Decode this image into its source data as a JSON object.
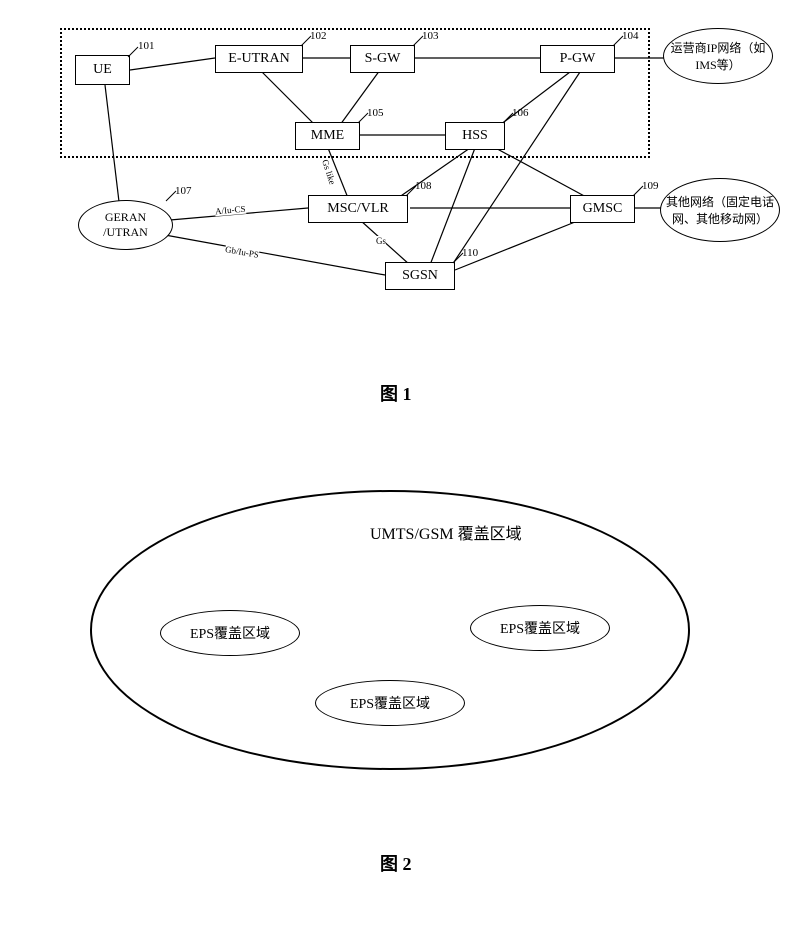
{
  "figure1": {
    "nodes": {
      "ue": {
        "label": "UE",
        "num": "101"
      },
      "eutran": {
        "label": "E-UTRAN",
        "num": "102"
      },
      "sgw": {
        "label": "S-GW",
        "num": "103"
      },
      "pgw": {
        "label": "P-GW",
        "num": "104"
      },
      "mme": {
        "label": "MME",
        "num": "105"
      },
      "hss": {
        "label": "HSS",
        "num": "106"
      },
      "geran": {
        "label": "GERAN\n/UTRAN",
        "num": "107"
      },
      "mscvlr": {
        "label": "MSC/VLR",
        "num": "108"
      },
      "gmsc": {
        "label": "GMSC",
        "num": "109"
      },
      "sgsn": {
        "label": "SGSN",
        "num": "110"
      },
      "ipnet": {
        "label": "运营商IP网络（如IMS等）"
      },
      "othernet": {
        "label": "其他网络（固定电话网、其他移动网）"
      }
    },
    "edge_labels": {
      "gslike": "Gs like",
      "aiucs": "A/Iu-CS",
      "gs": "Gs",
      "gbiups": "Gb/Iu-PS"
    },
    "caption": "图 1"
  },
  "figure2": {
    "outer_label": "UMTS/GSM 覆盖区域",
    "inner_label": "EPS覆盖区域",
    "caption": "图 2"
  }
}
